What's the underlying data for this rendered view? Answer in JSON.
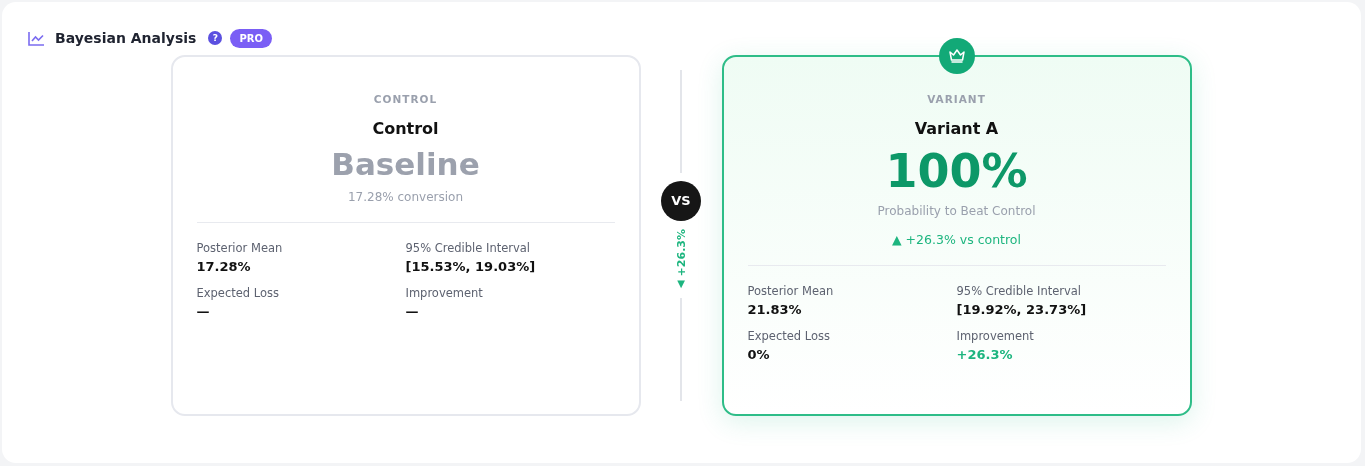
{
  "header": {
    "title": "Bayesian Analysis",
    "help": "?",
    "badge": "PRO"
  },
  "cards": [
    {
      "eyebrow": "CONTROL",
      "name": "Control",
      "winner": false,
      "headline": "Baseline",
      "caption": "17.28% conversion",
      "stats": [
        {
          "label": "Posterior Mean",
          "value": "17.28%",
          "positive": false
        },
        {
          "label": "95% Credible Interval",
          "value": "[15.53%, 19.03%]",
          "positive": false
        },
        {
          "label": "Expected Loss",
          "value": "—",
          "positive": false
        },
        {
          "label": "Improvement",
          "value": "—",
          "positive": false
        }
      ]
    },
    {
      "eyebrow": "VARIANT",
      "name": "Variant A",
      "winner": true,
      "headline": "100%",
      "caption": "Probability to Beat Control",
      "lift": "▲ +26.3% vs control",
      "stats": [
        {
          "label": "Posterior Mean",
          "value": "21.83%",
          "positive": false
        },
        {
          "label": "95% Credible Interval",
          "value": "[19.92%, 23.73%]",
          "positive": false
        },
        {
          "label": "Expected Loss",
          "value": "0%",
          "positive": false
        },
        {
          "label": "Improvement",
          "value": "+26.3%",
          "positive": true
        }
      ]
    }
  ],
  "divider": {
    "vs": "VS",
    "lift": "+26.3%",
    "arrow": "▼"
  }
}
